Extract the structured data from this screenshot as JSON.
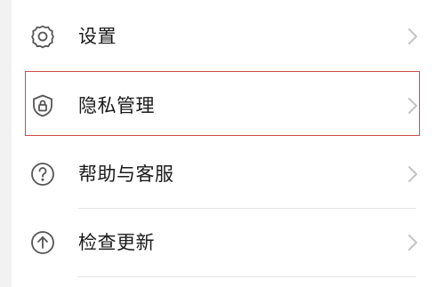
{
  "menu": {
    "items": [
      {
        "label": "设置",
        "icon": "gear-icon"
      },
      {
        "label": "隐私管理",
        "icon": "shield-lock-icon"
      },
      {
        "label": "帮助与客服",
        "icon": "help-circle-icon"
      },
      {
        "label": "检查更新",
        "icon": "arrow-up-circle-icon"
      }
    ]
  },
  "colors": {
    "text": "#1a1a1a",
    "icon": "#555555",
    "chevron": "#c4c4c4",
    "highlight_border": "#d24a4a",
    "divider": "#e4e4e4"
  }
}
